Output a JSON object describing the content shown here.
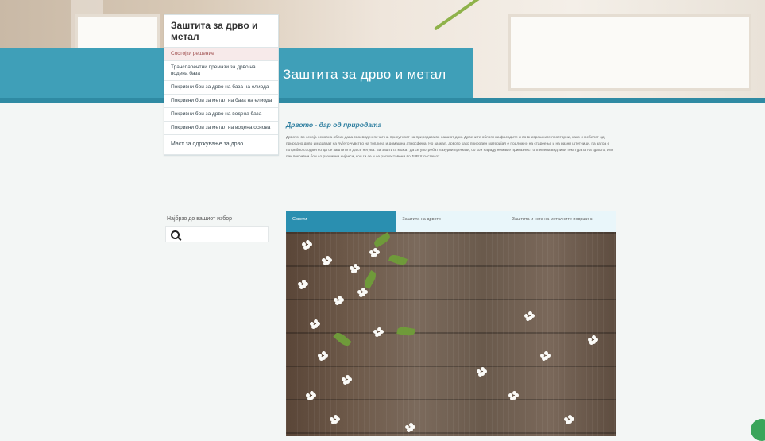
{
  "header": {
    "title": "Заштита за дрво и метал"
  },
  "menu": {
    "heading": "Заштита за дрво и метал",
    "items": [
      {
        "label": "Состојки решение"
      },
      {
        "label": "Транспарентни премази за дрво на водена база"
      },
      {
        "label": "Покривни бои за дрво на база на елиода"
      },
      {
        "label": "Покривни бои за метал на база на елиода"
      },
      {
        "label": "Покривни бои за дрво на водена база"
      },
      {
        "label": "Покривни бои за метал на водена основа"
      },
      {
        "label": "Маст за одржување за дрво"
      }
    ]
  },
  "search": {
    "label": "Најбрзо до вашиот избор",
    "placeholder": ""
  },
  "main": {
    "subtitle": "Дрвото - дар од природата",
    "body": "Дрвото, во секоја основна облик дава своевиден печат на присутност на природата во нашиот дом. Дрвените облоги на фасадите и во внатрешните простории, како и мебелот од природно дрво им даваат на луѓето чувство на топлина и домашна атмосфера. Но за жал, дрвото како природен материјал е подложно на стареење и на разни штетници, па затоа е потребно соодветно да се заштити и да се негува. За заштита можат да се употребат лазурни премази, со кои нараду немаме приказност оплемена видливи текстурата на дрвото, или пак покривни бои со различни нијанси, кои ги се и се распоставени во JUBIX системот."
  },
  "tabs": [
    {
      "label": "Совети",
      "active": true
    },
    {
      "label": "Заштита на дрвото",
      "active": false
    },
    {
      "label": "Заштита и нега на металните површини",
      "active": false
    }
  ]
}
